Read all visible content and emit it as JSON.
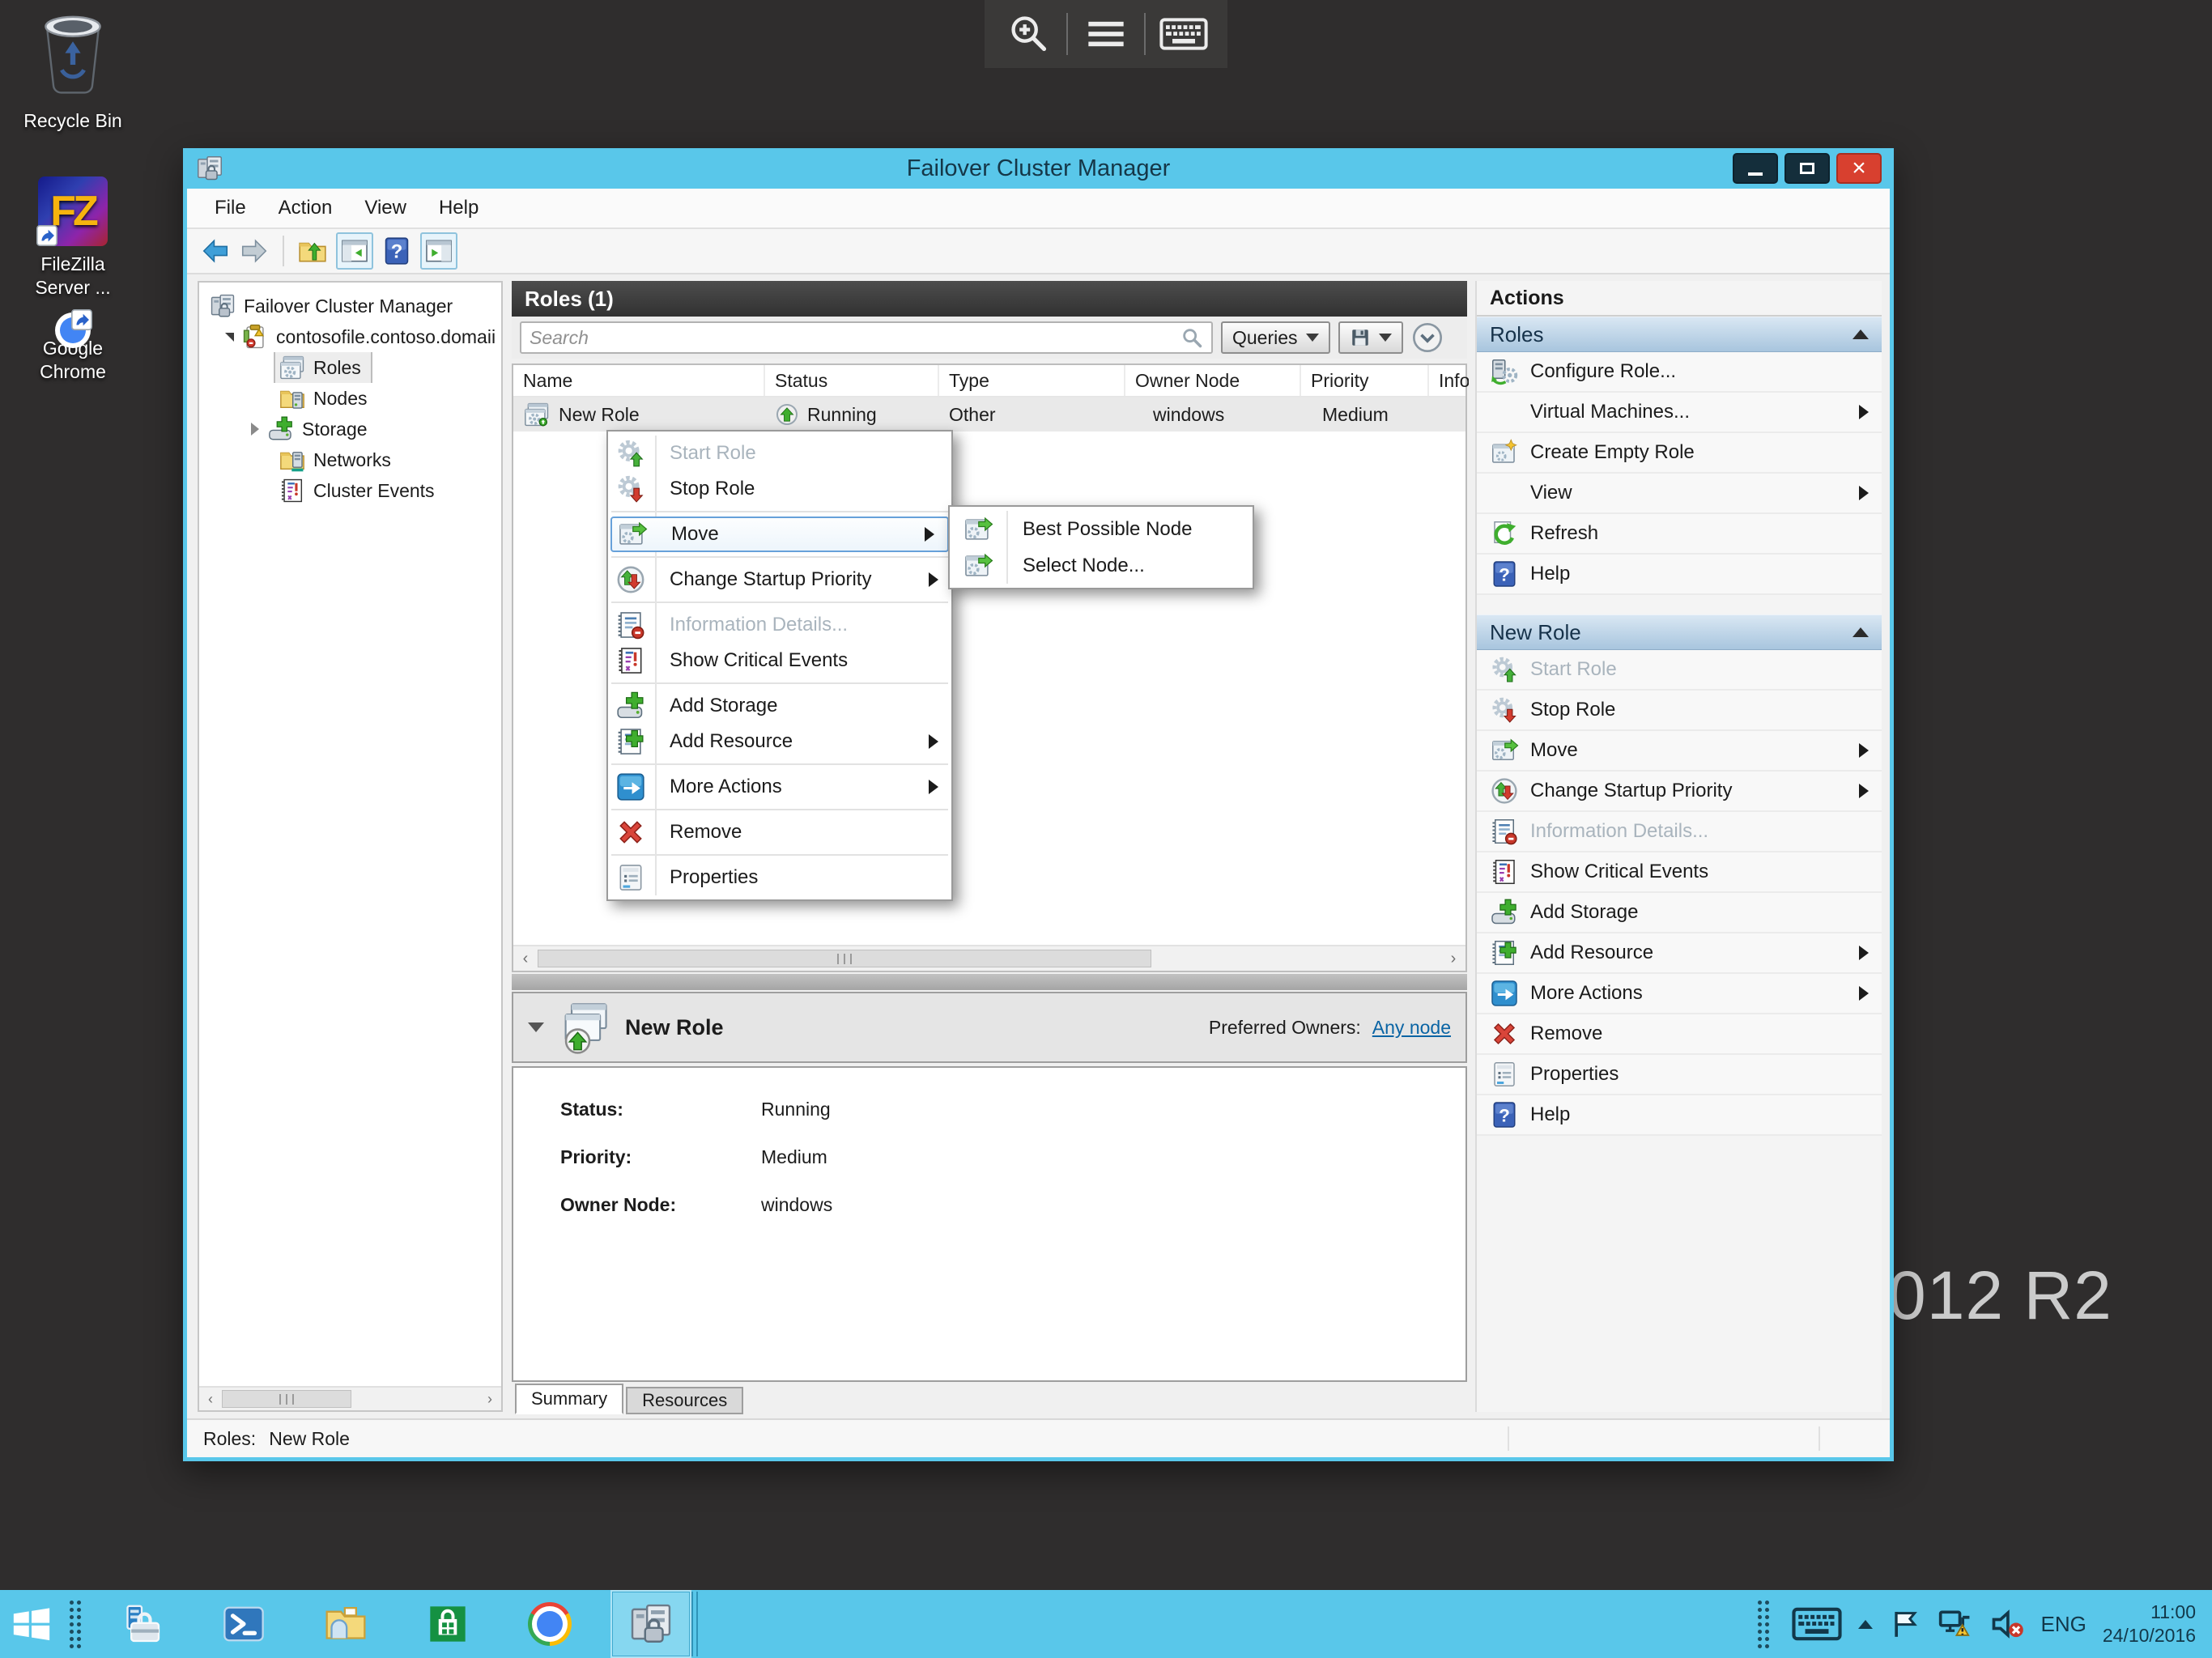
{
  "console_toolbar": {
    "icons": [
      "zoom-in-icon",
      "menu-icon",
      "keyboard-icon"
    ]
  },
  "desktop": {
    "watermark": "012 R2",
    "icons": [
      {
        "name": "recycle-bin",
        "lines": [
          "Recycle Bin"
        ]
      },
      {
        "name": "filezilla-server",
        "lines": [
          "FileZilla",
          "Server ..."
        ]
      },
      {
        "name": "google-chrome",
        "lines": [
          "Google",
          "Chrome"
        ]
      }
    ]
  },
  "window": {
    "title": "Failover Cluster Manager",
    "menu": [
      "File",
      "Action",
      "View",
      "Help"
    ],
    "tree": {
      "root": "Failover Cluster Manager",
      "cluster": "contosofile.contoso.domaii",
      "items": [
        "Roles",
        "Nodes",
        "Storage",
        "Networks",
        "Cluster Events"
      ],
      "selected": "Roles"
    },
    "list": {
      "header": "Roles (1)",
      "search_placeholder": "Search",
      "queries_button": "Queries",
      "save_icon": "save-icon",
      "columns": [
        "Name",
        "Status",
        "Type",
        "Owner Node",
        "Priority",
        "Information"
      ],
      "row": {
        "name": "New Role",
        "status": "Running",
        "type": "Other",
        "owner_node": "windows",
        "priority": "Medium"
      }
    },
    "context_menu": {
      "items": [
        {
          "label": "Start Role",
          "icon": "gear-start-icon",
          "disabled": true
        },
        {
          "label": "Stop Role",
          "icon": "gear-stop-icon"
        },
        {
          "label": "Move",
          "icon": "move-icon",
          "submenu": true,
          "highlighted": true
        },
        {
          "label": "Change Startup Priority",
          "icon": "priority-icon",
          "submenu": true
        },
        {
          "label": "Information Details...",
          "icon": "information-details-icon",
          "disabled": true
        },
        {
          "label": "Show Critical Events",
          "icon": "critical-events-icon"
        },
        {
          "label": "Add Storage",
          "icon": "add-storage-icon"
        },
        {
          "label": "Add Resource",
          "icon": "add-resource-icon",
          "submenu": true
        },
        {
          "label": "More Actions",
          "icon": "more-actions-icon",
          "submenu": true
        },
        {
          "label": "Remove",
          "icon": "remove-icon"
        },
        {
          "label": "Properties",
          "icon": "properties-icon"
        }
      ],
      "move_submenu": [
        {
          "label": "Best Possible Node",
          "icon": "move-icon"
        },
        {
          "label": "Select Node...",
          "icon": "move-icon"
        }
      ]
    },
    "actions": {
      "title": "Actions",
      "sections": [
        {
          "header": "Roles",
          "items": [
            {
              "label": "Configure Role...",
              "icon": "configure-role-icon"
            },
            {
              "label": "Virtual Machines...",
              "submenu": true
            },
            {
              "label": "Create Empty Role",
              "icon": "create-empty-role-icon"
            },
            {
              "label": "View",
              "submenu": true
            },
            {
              "label": "Refresh",
              "icon": "refresh-icon"
            },
            {
              "label": "Help",
              "icon": "help-icon"
            }
          ]
        },
        {
          "header": "New Role",
          "items": [
            {
              "label": "Start Role",
              "icon": "gear-start-icon",
              "disabled": true
            },
            {
              "label": "Stop Role",
              "icon": "gear-stop-icon"
            },
            {
              "label": "Move",
              "icon": "move-icon",
              "submenu": true
            },
            {
              "label": "Change Startup Priority",
              "icon": "priority-icon",
              "submenu": true
            },
            {
              "label": "Information Details...",
              "icon": "information-details-icon",
              "disabled": true
            },
            {
              "label": "Show Critical Events",
              "icon": "critical-events-icon"
            },
            {
              "label": "Add Storage",
              "icon": "add-storage-icon"
            },
            {
              "label": "Add Resource",
              "icon": "add-resource-icon",
              "submenu": true
            },
            {
              "label": "More Actions",
              "icon": "more-actions-icon",
              "submenu": true
            },
            {
              "label": "Remove",
              "icon": "remove-icon"
            },
            {
              "label": "Properties",
              "icon": "properties-icon"
            },
            {
              "label": "Help",
              "icon": "help-icon"
            }
          ]
        }
      ]
    },
    "detail": {
      "title": "New Role",
      "preferred_owners_label": "Preferred Owners:",
      "preferred_owners_link": "Any node",
      "fields": [
        {
          "label": "Status:",
          "value": "Running"
        },
        {
          "label": "Priority:",
          "value": "Medium"
        },
        {
          "label": "Owner Node:",
          "value": "windows"
        }
      ],
      "tabs": [
        "Summary",
        "Resources"
      ]
    },
    "status_bar": {
      "prefix": "Roles:",
      "value": "New Role"
    }
  },
  "taskbar": {
    "apps": [
      "start",
      "server-manager",
      "powershell",
      "file-explorer",
      "windows-store",
      "chrome",
      "failover-cluster-manager"
    ],
    "tray": {
      "icons": [
        "keyboard-icon",
        "chevron-up-icon",
        "flag-icon",
        "network-warning-icon",
        "volume-muted-icon"
      ],
      "language": "ENG",
      "time": "11:00",
      "date": "24/10/2016"
    }
  }
}
